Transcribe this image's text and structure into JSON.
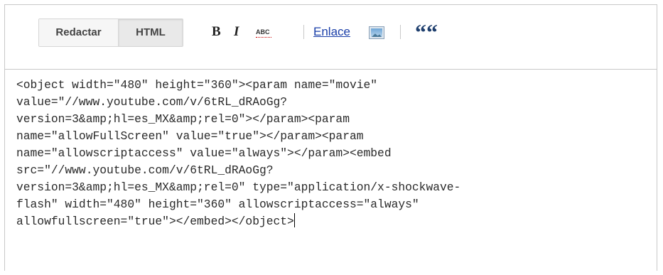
{
  "toolbar": {
    "compose_label": "Redactar",
    "html_label": "HTML",
    "bold_label": "B",
    "italic_label": "I",
    "spellcheck_label": "ABC",
    "link_label": "Enlace",
    "image_icon": "image-icon",
    "quote_label": "““"
  },
  "editor": {
    "lines": [
      "<object width=\"480\" height=\"360\"><param name=\"movie\"",
      "value=\"//www.youtube.com/v/6tRL_dRAoGg?",
      "version=3&amp;hl=es_MX&amp;rel=0\"></param><param",
      "name=\"allowFullScreen\" value=\"true\"></param><param",
      "name=\"allowscriptaccess\" value=\"always\"></param><embed",
      "src=\"//www.youtube.com/v/6tRL_dRAoGg?",
      "version=3&amp;hl=es_MX&amp;rel=0\" type=\"application/x-shockwave-",
      "flash\" width=\"480\" height=\"360\" allowscriptaccess=\"always\"",
      "allowfullscreen=\"true\"></embed></object>"
    ]
  }
}
